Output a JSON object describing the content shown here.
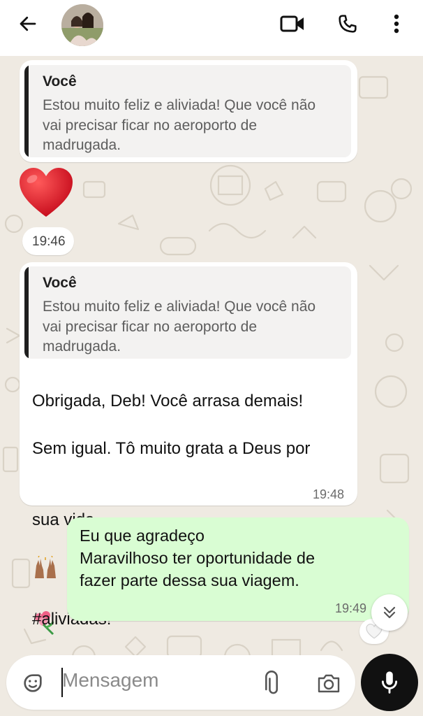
{
  "header": {
    "back_icon": "arrow-left-icon",
    "avatar": "contact-avatar",
    "video_icon": "video-call-icon",
    "call_icon": "phone-icon",
    "menu_icon": "more-vert-icon"
  },
  "messages": {
    "m1": {
      "quote_author": "Você",
      "quote_text": "Estou muito feliz e aliviada! Que você não vai precisar ficar no aeroporto de madrugada."
    },
    "heart_time": "19:46",
    "m2": {
      "quote_author": "Você",
      "quote_text": "Estou muito feliz e aliviada! Que você não vai precisar ficar no aeroporto de madrugada.",
      "line1": "Obrigada, Deb! Você arrasa demais!",
      "line2": "Sem igual. Tô muito grata a Deus por",
      "line3": "sua vida.",
      "hashtag": "#aliviadas!",
      "time": "19:48"
    },
    "m3": {
      "text": "Eu que agradeço\nMaravilhoso ter oportunidade de\nfazer parte dessa sua viagem.",
      "time": "19:49"
    }
  },
  "composer": {
    "placeholder": "Mensagem",
    "sticker_icon": "sticker-icon",
    "attach_icon": "paperclip-icon",
    "camera_icon": "camera-icon",
    "mic_icon": "microphone-icon"
  },
  "colors": {
    "background": "#efeae2",
    "incoming_bubble": "#ffffff",
    "outgoing_bubble": "#d9fdd3",
    "mic_button": "#111111"
  }
}
